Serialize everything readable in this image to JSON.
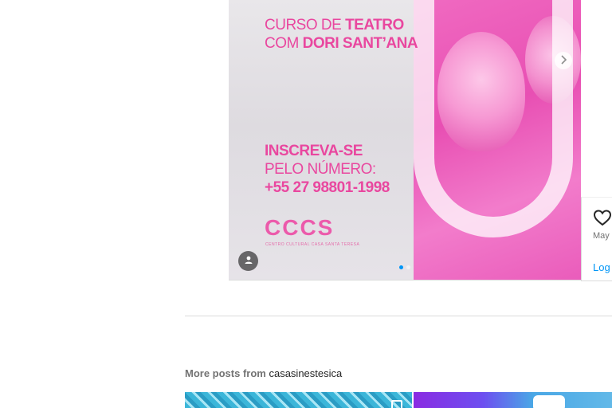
{
  "post": {
    "course_line1_pre": "CURSO DE ",
    "course_line1_bold": "TEATRO",
    "course_line2_pre": "COM ",
    "course_line2_bold": "DORI SANT’ANA",
    "signup_line1": "INSCREVA-SE",
    "signup_line2": "PELO NÚMERO:",
    "signup_phone": "+55 27 98801-1998",
    "logo_text": "CCCS",
    "logo_subtext": "CENTRO CULTURAL CASA SANTA TERESA",
    "carousel_total": 2,
    "carousel_active": 1
  },
  "icons": {
    "next": "chevron-right-icon",
    "user_tag": "user-icon",
    "like": "heart-icon"
  },
  "side": {
    "date": "May",
    "login": "Log"
  },
  "more_posts": {
    "label": "More posts from",
    "author": "casasinestesica"
  },
  "colors": {
    "accent": "#0095f6",
    "brand_pink": "#e9479f"
  }
}
